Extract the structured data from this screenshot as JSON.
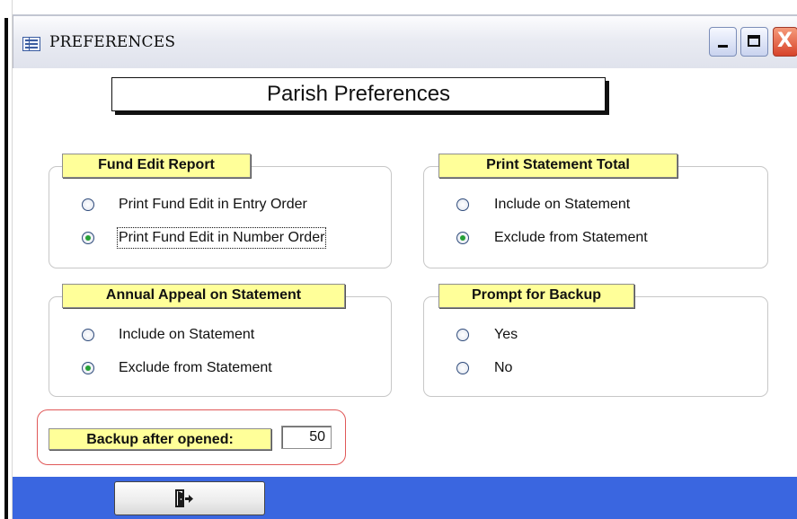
{
  "window": {
    "title": "PREFERENCES",
    "minimize_glyph": "",
    "maximize_glyph": "",
    "close_glyph": "X"
  },
  "header": {
    "title": "Parish Preferences"
  },
  "groups": {
    "fund_edit": {
      "label": "Fund Edit Report",
      "options": [
        "Print Fund Edit in Entry Order",
        "Print Fund Edit in Number Order"
      ],
      "selected_index": 1
    },
    "statement_total": {
      "label": "Print Statement Total",
      "options": [
        "Include on Statement",
        "Exclude from Statement"
      ],
      "selected_index": 1
    },
    "annual_appeal": {
      "label": "Annual Appeal on Statement",
      "options": [
        "Include on Statement",
        "Exclude from Statement"
      ],
      "selected_index": 1
    },
    "backup_prompt": {
      "label": "Prompt for Backup",
      "options": [
        "Yes",
        "No"
      ],
      "selected_index": -1
    }
  },
  "backup": {
    "label": "Backup after opened:",
    "value": "50"
  },
  "footer": {
    "exit_icon": "exit-door-icon"
  },
  "colors": {
    "legend_bg": "#ffff99",
    "footer_bar": "#3a66e0",
    "radio_selected": "#26a036",
    "highlight_ring": "#e05858"
  }
}
